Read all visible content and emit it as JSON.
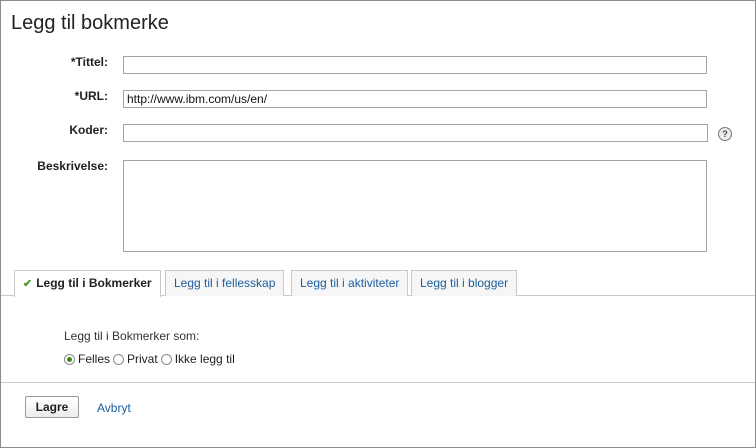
{
  "page": {
    "title": "Legg til bokmerke"
  },
  "form": {
    "title_label": "*Tittel:",
    "title_value": "",
    "url_label": "*URL:",
    "url_value": "http://www.ibm.com/us/en/",
    "tags_label": "Koder:",
    "tags_value": "",
    "help_glyph": "?",
    "description_label": "Beskrivelse:",
    "description_value": ""
  },
  "tabs": [
    {
      "label": "Legg til i Bokmerker",
      "active": true,
      "icon": "check-icon",
      "icon_glyph": "✔"
    },
    {
      "label": "Legg til i fellesskap",
      "active": false
    },
    {
      "label": "Legg til i aktiviteter",
      "active": false
    },
    {
      "label": "Legg til i blogger",
      "active": false
    }
  ],
  "panel": {
    "heading": "Legg til i Bokmerker som:",
    "options": [
      {
        "label": "Felles",
        "selected": true
      },
      {
        "label": "Privat",
        "selected": false
      },
      {
        "label": "Ikke legg til",
        "selected": false
      }
    ]
  },
  "footer": {
    "save_label": "Lagre",
    "cancel_label": "Avbryt"
  },
  "colors": {
    "link": "#1c5e9d",
    "active_check": "#4c9a2a",
    "border": "#a5a5a5"
  }
}
